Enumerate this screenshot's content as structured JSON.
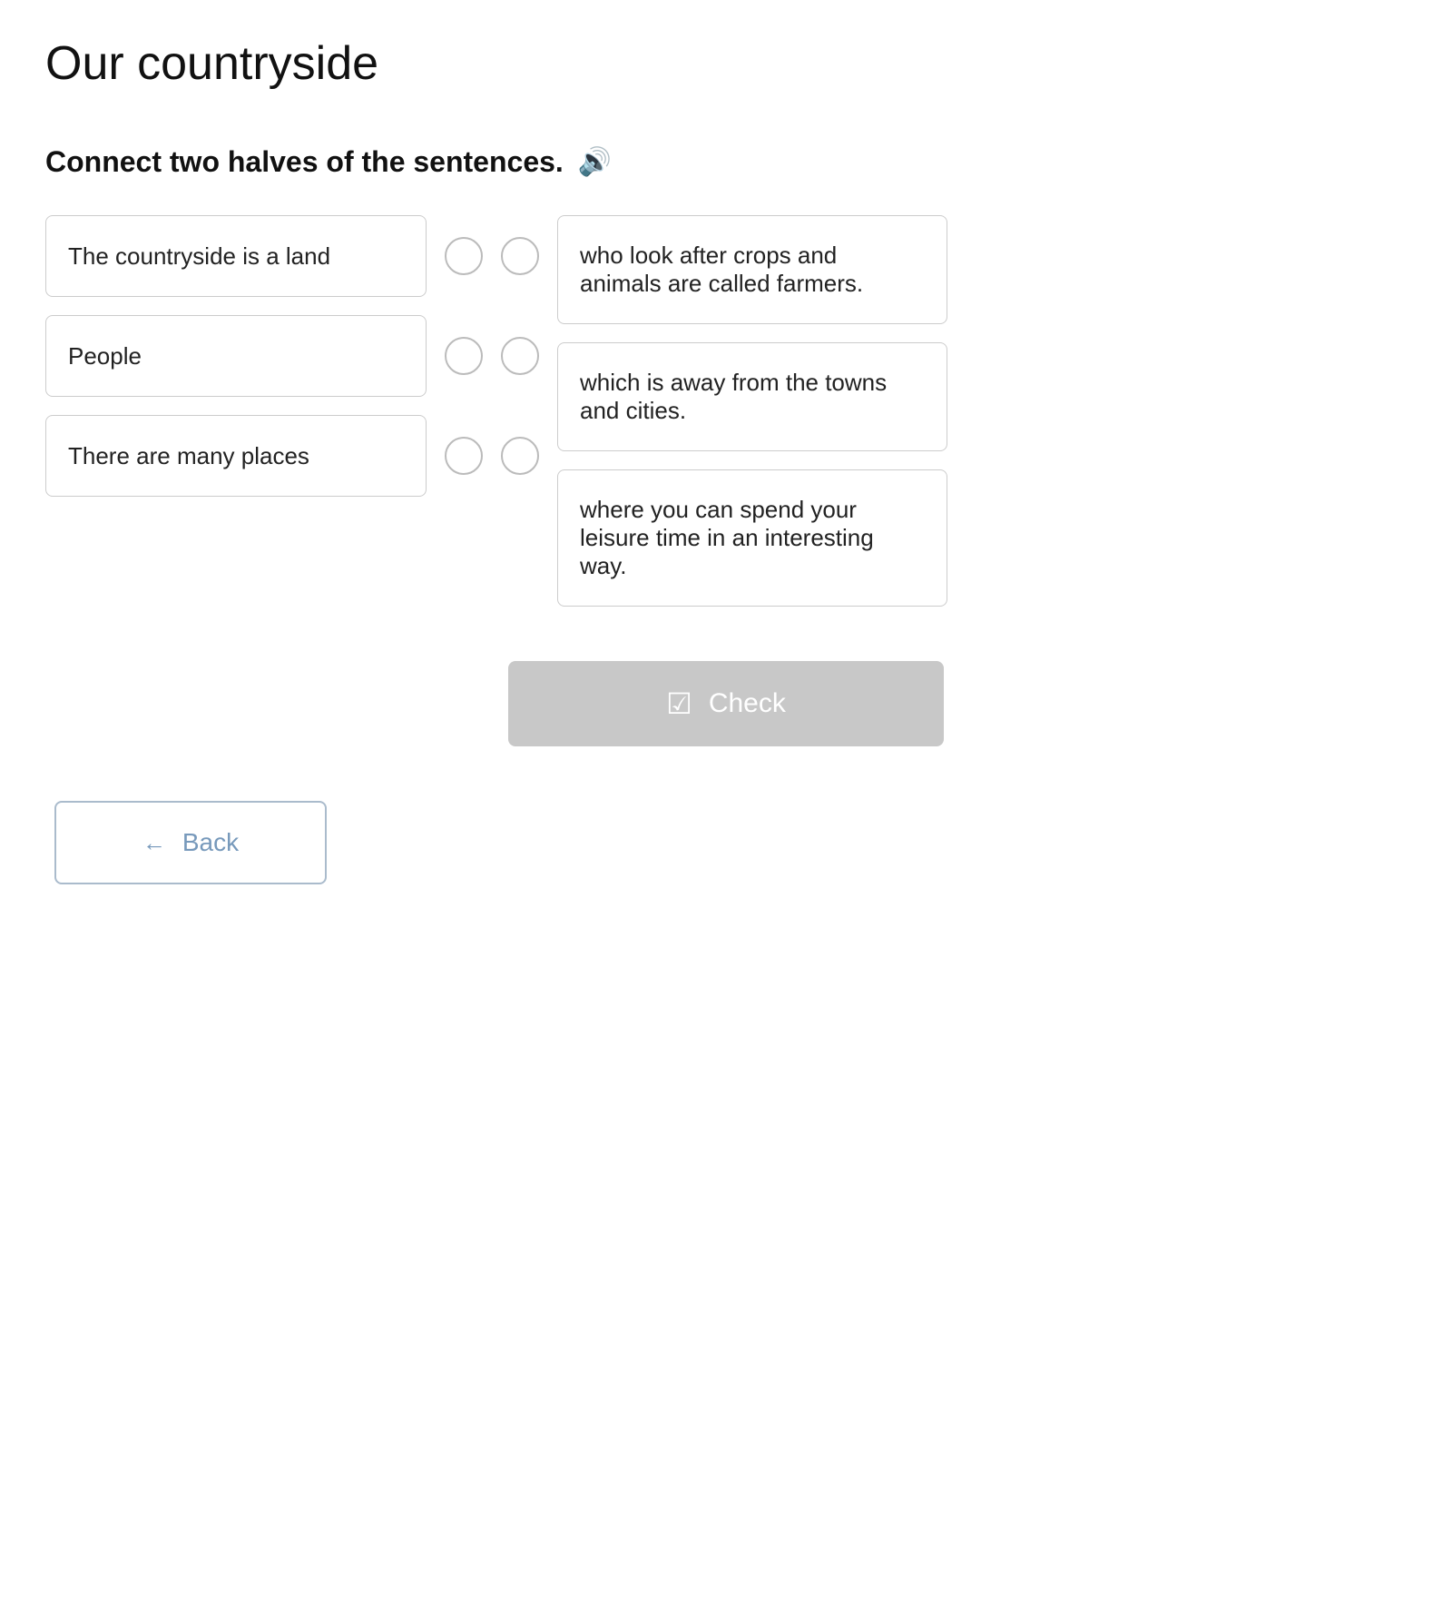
{
  "page": {
    "title": "Our countryside",
    "instruction": "Connect two halves of the sentences.",
    "audio_icon": "🔊",
    "left_sentences": [
      {
        "id": "s1",
        "text": "The countryside is a land"
      },
      {
        "id": "s2",
        "text": "People"
      },
      {
        "id": "s3",
        "text": "There are many places"
      }
    ],
    "right_sentences": [
      {
        "id": "r1",
        "text": "who look after crops and animals are called farmers."
      },
      {
        "id": "r2",
        "text": "which is away from the towns and cities."
      },
      {
        "id": "r3",
        "text": "where you can spend your leisure time in an interesting way."
      }
    ],
    "check_button_label": "Check",
    "back_button_label": "Back"
  }
}
